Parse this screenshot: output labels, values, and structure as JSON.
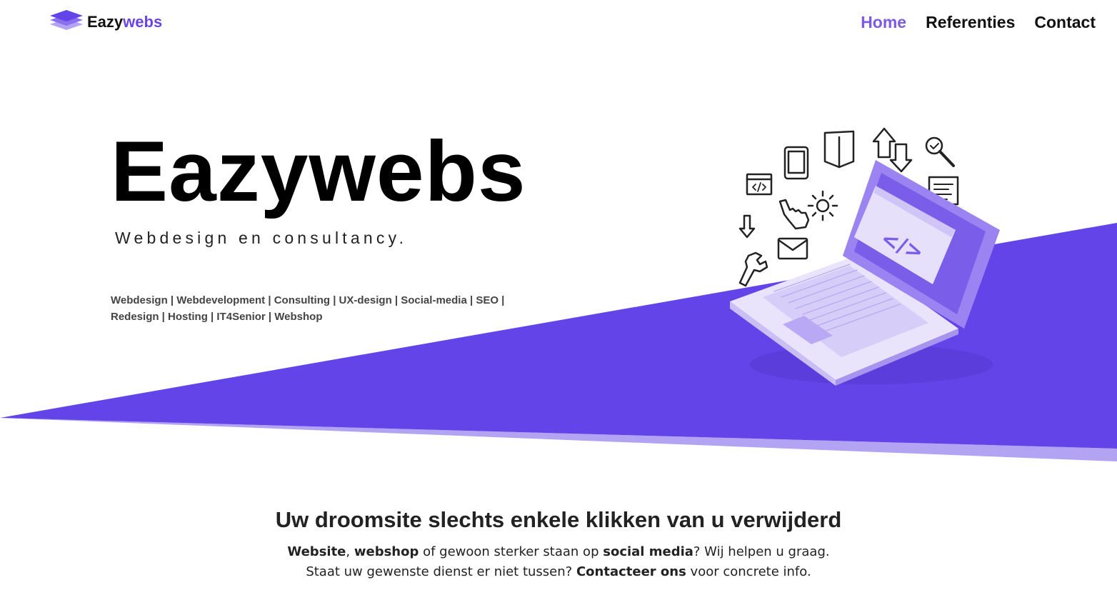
{
  "header": {
    "logo_text_a": "Eazy",
    "logo_text_b": "webs",
    "nav": [
      {
        "label": "Home",
        "active": true
      },
      {
        "label": "Referenties",
        "active": false
      },
      {
        "label": "Contact",
        "active": false
      }
    ]
  },
  "hero": {
    "title": "Eazywebs",
    "subtitle": "Webdesign en consultancy.",
    "services_line1": "Webdesign | Webdevelopment | Consulting | UX-design | Social-media | SEO |",
    "services_line2": "Redesign | Hosting | IT4Senior | Webshop",
    "illustration_code_glyph": "</>"
  },
  "intro": {
    "heading": "Uw droomsite slechts enkele klikken van u verwijderd",
    "p1": {
      "b1": "Website",
      "t1": ", ",
      "b2": "webshop",
      "t2": " of gewoon sterker staan op ",
      "b3": "social media",
      "t3": "? Wij helpen u graag."
    },
    "p2": {
      "t1": "Staat uw gewenste dienst er niet tussen? ",
      "b1": "Contacteer ons",
      "t2": " voor concrete info."
    }
  },
  "colors": {
    "accent": "#6244e8",
    "accent_light": "#b3a3f3",
    "nav_active": "#7b5ae6"
  },
  "icons": [
    "logo-layers-icon",
    "code-window-icon",
    "tablet-icon",
    "book-icon",
    "up-down-arrows-icon",
    "search-check-icon",
    "document-lines-icon",
    "pointer-hand-icon",
    "gear-icon",
    "down-arrow-icon",
    "mail-icon",
    "wrench-icon",
    "laptop-illustration"
  ]
}
